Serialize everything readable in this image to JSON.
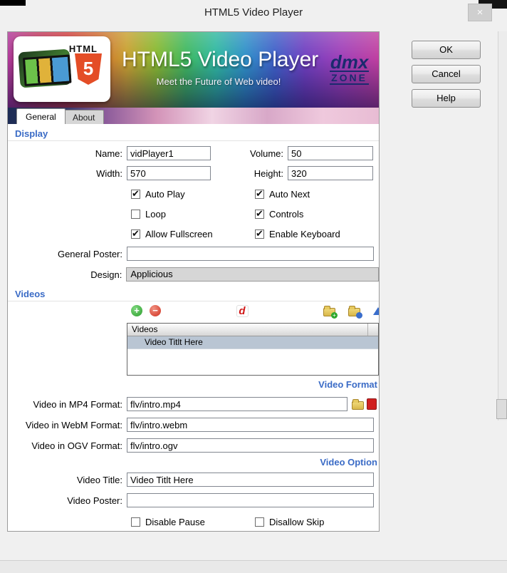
{
  "window": {
    "title": "HTML5 Video Player",
    "close_glyph": "×"
  },
  "action_buttons": {
    "ok": "OK",
    "cancel": "Cancel",
    "help": "Help"
  },
  "banner": {
    "title": "HTML5 Video Player",
    "subtitle": "Meet the Future of Web video!",
    "logo_word": "HTML",
    "logo_number": "5",
    "brand_top": "dmx",
    "brand_bottom": "ZONE"
  },
  "tabs": [
    {
      "label": "General"
    },
    {
      "label": "About"
    }
  ],
  "display": {
    "heading": "Display",
    "name_label": "Name:",
    "name_value": "vidPlayer1",
    "volume_label": "Volume:",
    "volume_value": "50",
    "width_label": "Width:",
    "width_value": "570",
    "height_label": "Height:",
    "height_value": "320",
    "autoplay_label": "Auto Play",
    "autonext_label": "Auto Next",
    "loop_label": "Loop",
    "controls_label": "Controls",
    "fullscreen_label": "Allow Fullscreen",
    "keyboard_label": "Enable Keyboard",
    "poster_label": "General Poster:",
    "poster_value": "",
    "design_label": "Design:",
    "design_value": "Applicious",
    "checks": {
      "autoplay": true,
      "autonext": true,
      "loop": false,
      "controls": true,
      "fullscreen": true,
      "keyboard": true
    }
  },
  "videos": {
    "heading": "Videos",
    "toolbar": {
      "add_glyph": "+",
      "remove_glyph": "−",
      "dmx_glyph": "d"
    },
    "list_header": "Videos",
    "row_title": "Video Titlt Here",
    "format_link": "Video Format",
    "mp4_label": "Video in MP4 Format:",
    "mp4_value": "flv/intro.mp4",
    "webm_label": "Video in WebM Format:",
    "webm_value": "flv/intro.webm",
    "ogv_label": "Video in OGV Format:",
    "ogv_value": "flv/intro.ogv",
    "options_link": "Video Option",
    "title_label": "Video Title:",
    "title_value": "Video Titlt Here",
    "poster_label": "Video Poster:",
    "poster_value": "",
    "disable_pause_label": "Disable Pause",
    "disallow_skip_label": "Disallow Skip",
    "checks": {
      "disable_pause": false,
      "disallow_skip": false
    }
  },
  "colors": {
    "accent_blue": "#3a6bc6",
    "banner_navy": "#1c2a5c",
    "shield_orange": "#e44d26",
    "selected_row": "#b9c5d3"
  }
}
